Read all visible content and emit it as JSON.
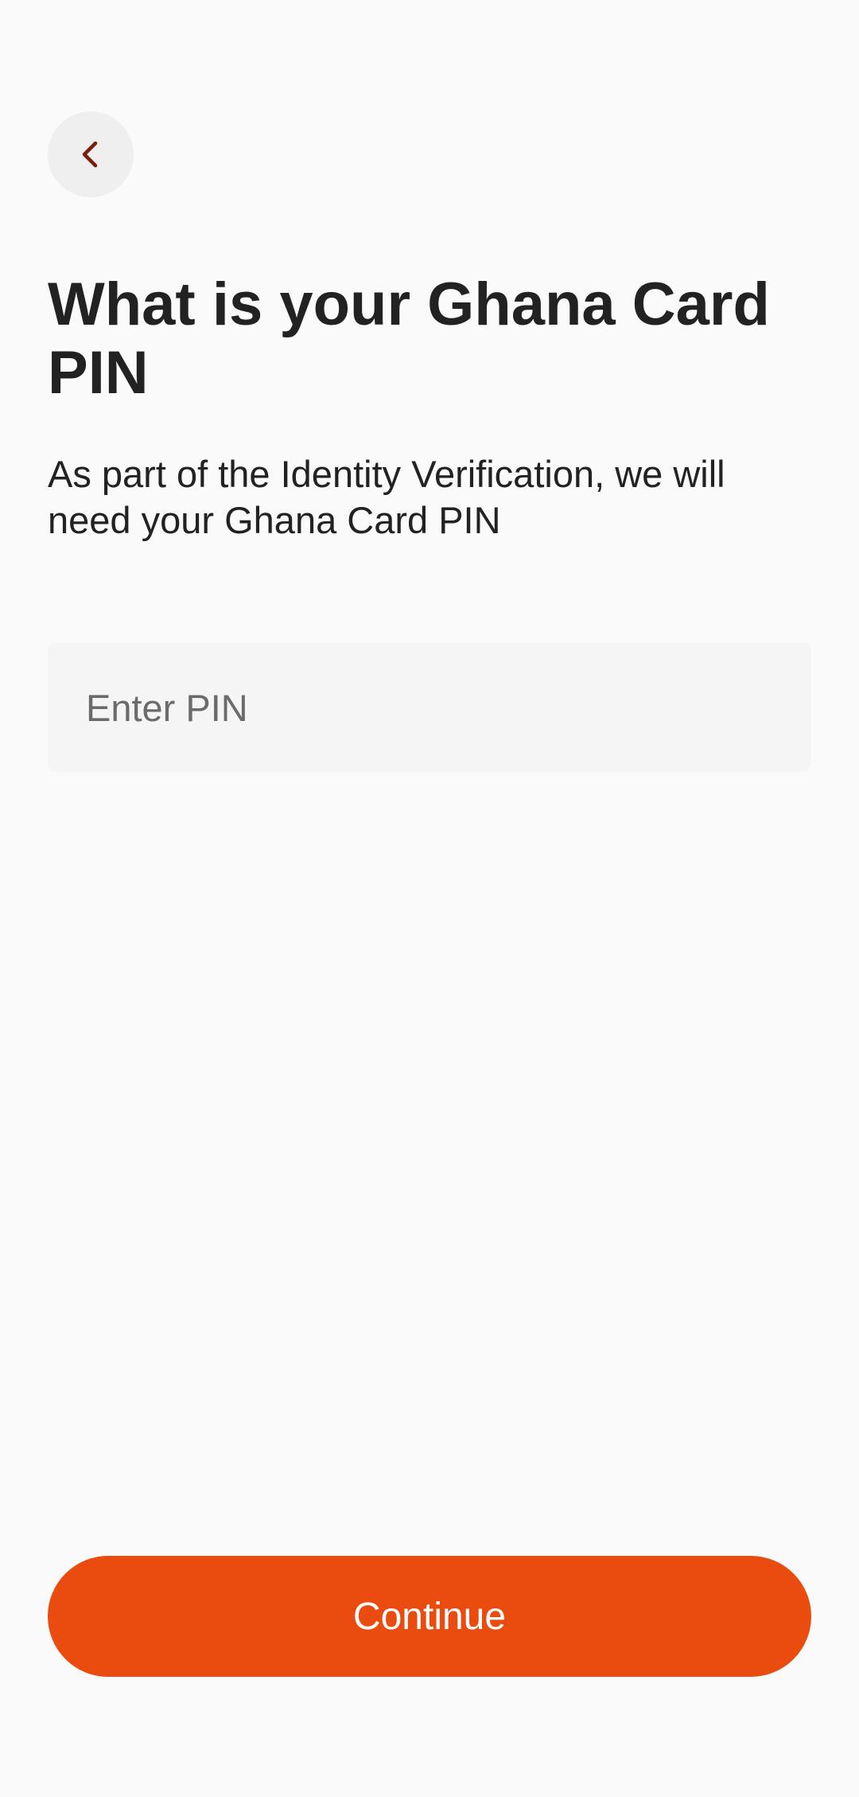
{
  "header": {
    "back_icon": "chevron-left-icon"
  },
  "main": {
    "title": "What is your Ghana Card PIN",
    "subtitle": "As part of the Identity Verification, we will need your Ghana Card PIN",
    "pin_input": {
      "placeholder": "Enter PIN",
      "value": ""
    }
  },
  "footer": {
    "continue_label": "Continue"
  },
  "colors": {
    "accent": "#ea4b0f",
    "back_icon": "#7a1f0c",
    "background": "#fafafa"
  }
}
